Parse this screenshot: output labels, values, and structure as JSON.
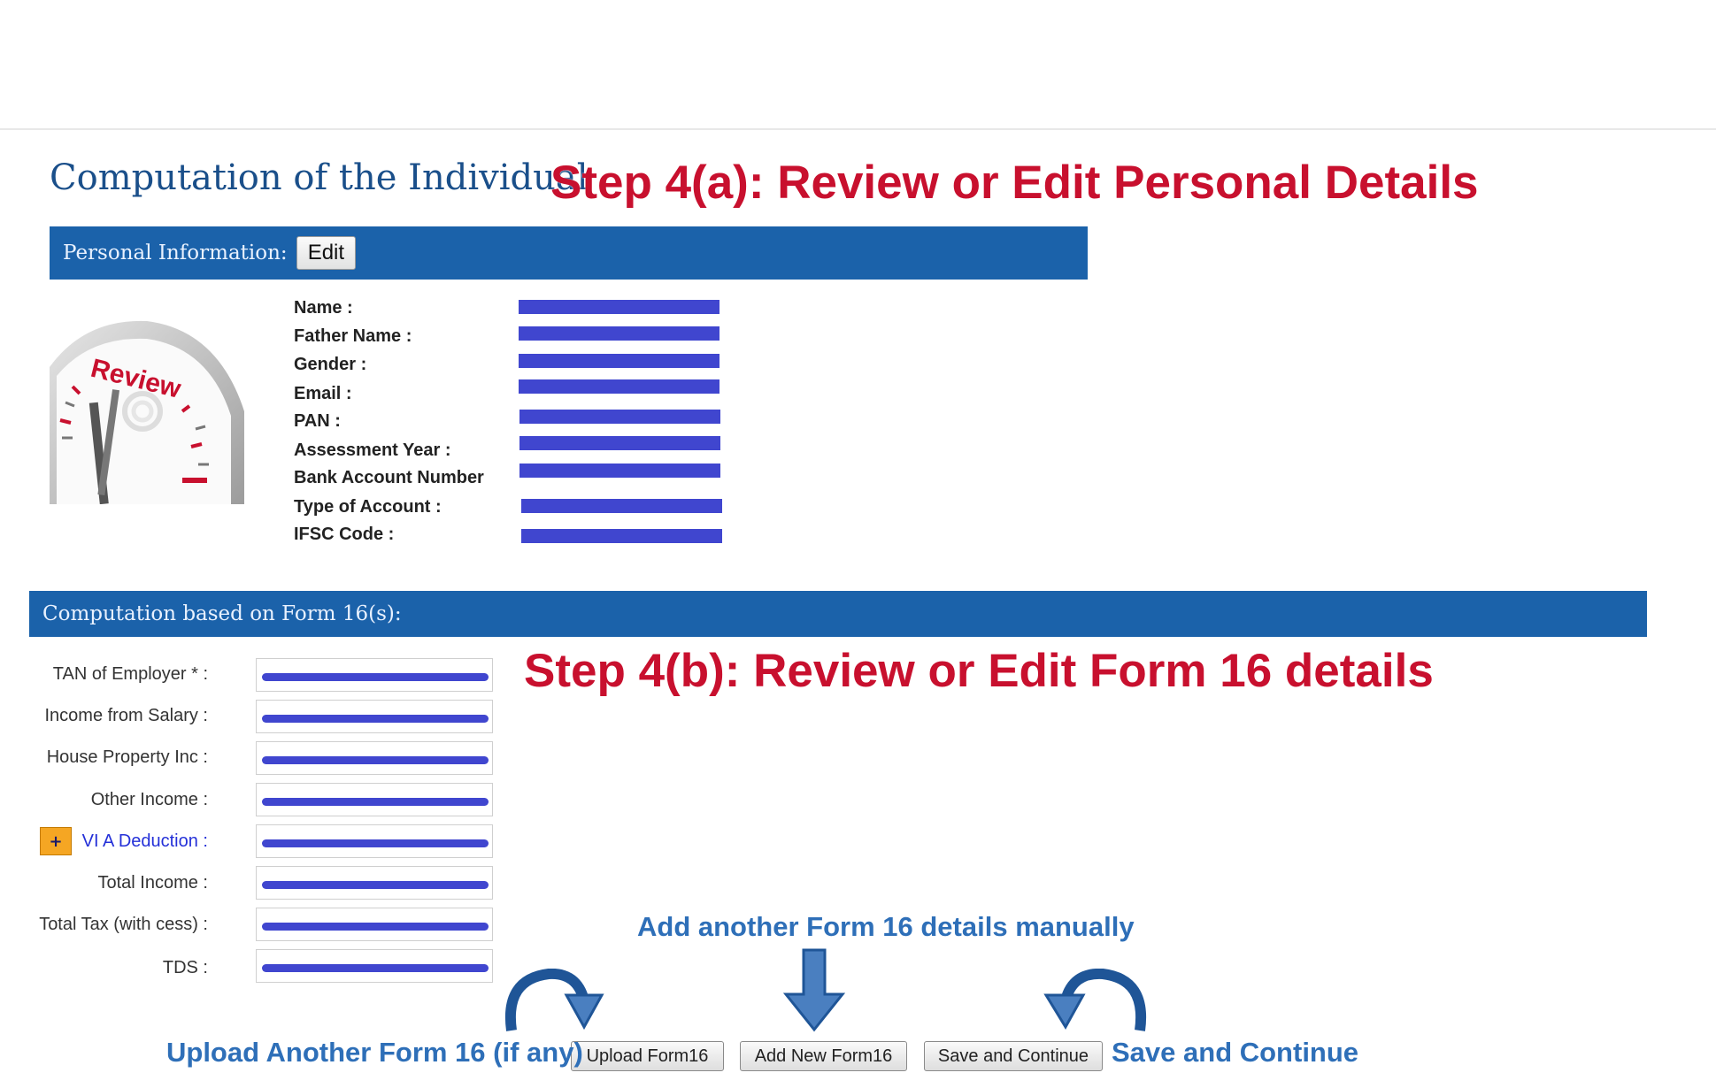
{
  "header": {
    "page_title": "Computation of the Individual",
    "step_a": "Step 4(a): Review or Edit Personal Details",
    "step_b": "Step 4(b): Review or Edit Form 16 details"
  },
  "personal": {
    "bar_label": "Personal Information:",
    "edit_label": "Edit",
    "image_text": "Review",
    "fields": [
      "Name :",
      "Father Name :",
      "Gender :",
      "Email :",
      "PAN :",
      "Assessment Year :",
      "Bank Account Number",
      "Type of Account :",
      "IFSC Code :"
    ]
  },
  "computation": {
    "bar_label": "Computation based on Form 16(s):",
    "plus_label": "+",
    "fields": [
      "TAN of Employer * :",
      "Income from Salary :",
      "House Property Inc :",
      "Other Income :",
      "VI A Deduction :",
      "Total Income :",
      "Total Tax (with cess) :",
      "TDS :"
    ]
  },
  "buttons": {
    "upload": "Upload Form16",
    "add": "Add New Form16",
    "save": "Save and Continue"
  },
  "notes": {
    "upload": "Upload Another Form 16 (if any)",
    "add": "Add another Form 16 details manually",
    "save": "Save and Continue"
  },
  "colors": {
    "header_bar": "#1b62aa",
    "step_text": "#c8102e",
    "note_text": "#2e6fb8",
    "redaction": "#4046cf"
  }
}
